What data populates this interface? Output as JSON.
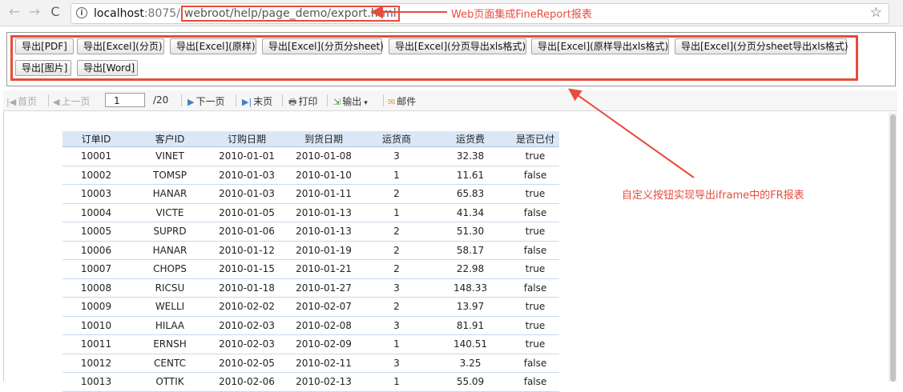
{
  "browser": {
    "back": "←",
    "forward": "→",
    "reload": "C",
    "url_host": "localhost",
    "url_port": ":8075/",
    "url_path": "webroot/help/page_demo/export.html",
    "info": "i",
    "star": "☆"
  },
  "annotations": {
    "top": "Web页面集成FineReport报表",
    "right": "自定义按钮实现导出iframe中的FR报表",
    "color": "#e74c3c"
  },
  "export_buttons": [
    "导出[PDF]",
    "导出[Excel](分页)",
    "导出[Excel](原样)",
    "导出[Excel](分页分sheet)",
    "导出[Excel](分页导出xls格式)",
    "导出[Excel](原样导出xls格式)",
    "导出[Excel](分页分sheet导出xls格式)",
    "导出[图片]",
    "导出[Word]"
  ],
  "toolbar": {
    "first": "首页",
    "prev": "上一页",
    "page_value": "1",
    "total": "/20",
    "next": "下一页",
    "last": "末页",
    "print": "打印",
    "output": "输出",
    "mail": "邮件"
  },
  "table": {
    "headers": [
      "订单ID",
      "客户ID",
      "订购日期",
      "到货日期",
      "运货商",
      "运货费",
      "是否已付"
    ],
    "rows": [
      [
        "10001",
        "VINET",
        "2010-01-01",
        "2010-01-08",
        "3",
        "32.38",
        "true"
      ],
      [
        "10002",
        "TOMSP",
        "2010-01-03",
        "2010-01-10",
        "1",
        "11.61",
        "false"
      ],
      [
        "10003",
        "HANAR",
        "2010-01-03",
        "2010-01-11",
        "2",
        "65.83",
        "true"
      ],
      [
        "10004",
        "VICTE",
        "2010-01-05",
        "2010-01-13",
        "1",
        "41.34",
        "false"
      ],
      [
        "10005",
        "SUPRD",
        "2010-01-06",
        "2010-01-13",
        "2",
        "51.30",
        "true"
      ],
      [
        "10006",
        "HANAR",
        "2010-01-12",
        "2010-01-19",
        "2",
        "58.17",
        "false"
      ],
      [
        "10007",
        "CHOPS",
        "2010-01-15",
        "2010-01-21",
        "2",
        "22.98",
        "true"
      ],
      [
        "10008",
        "RICSU",
        "2010-01-18",
        "2010-01-27",
        "3",
        "148.33",
        "false"
      ],
      [
        "10009",
        "WELLI",
        "2010-02-02",
        "2010-02-07",
        "2",
        "13.97",
        "true"
      ],
      [
        "10010",
        "HILAA",
        "2010-02-03",
        "2010-02-08",
        "3",
        "81.91",
        "true"
      ],
      [
        "10011",
        "ERNSH",
        "2010-02-03",
        "2010-02-09",
        "1",
        "140.51",
        "true"
      ],
      [
        "10012",
        "CENTC",
        "2010-02-05",
        "2010-02-11",
        "3",
        "3.25",
        "false"
      ],
      [
        "10013",
        "OTTIK",
        "2010-02-06",
        "2010-02-13",
        "1",
        "55.09",
        "false"
      ]
    ]
  }
}
